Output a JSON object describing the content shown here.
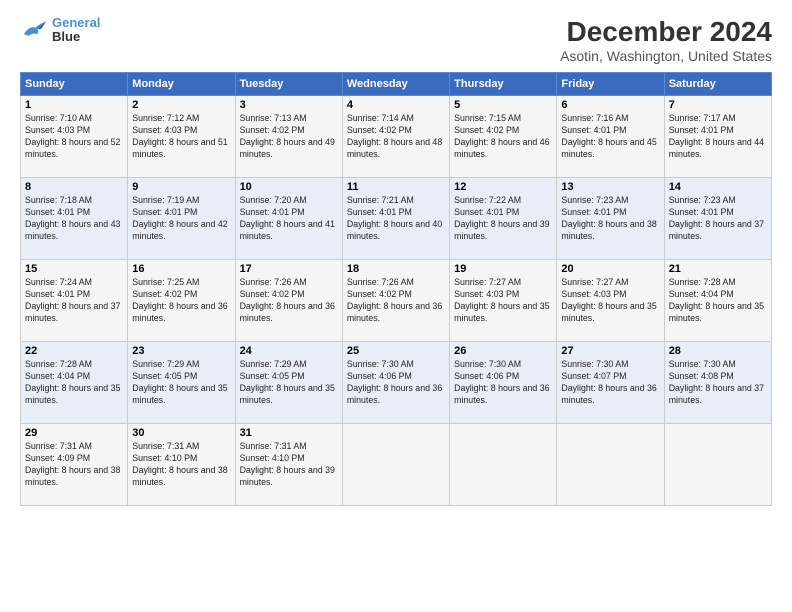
{
  "logo": {
    "line1": "General",
    "line2": "Blue"
  },
  "title": "December 2024",
  "subtitle": "Asotin, Washington, United States",
  "headers": [
    "Sunday",
    "Monday",
    "Tuesday",
    "Wednesday",
    "Thursday",
    "Friday",
    "Saturday"
  ],
  "weeks": [
    [
      {
        "day": "1",
        "sunrise": "7:10 AM",
        "sunset": "4:03 PM",
        "daylight": "8 hours and 52 minutes."
      },
      {
        "day": "2",
        "sunrise": "7:12 AM",
        "sunset": "4:03 PM",
        "daylight": "8 hours and 51 minutes."
      },
      {
        "day": "3",
        "sunrise": "7:13 AM",
        "sunset": "4:02 PM",
        "daylight": "8 hours and 49 minutes."
      },
      {
        "day": "4",
        "sunrise": "7:14 AM",
        "sunset": "4:02 PM",
        "daylight": "8 hours and 48 minutes."
      },
      {
        "day": "5",
        "sunrise": "7:15 AM",
        "sunset": "4:02 PM",
        "daylight": "8 hours and 46 minutes."
      },
      {
        "day": "6",
        "sunrise": "7:16 AM",
        "sunset": "4:01 PM",
        "daylight": "8 hours and 45 minutes."
      },
      {
        "day": "7",
        "sunrise": "7:17 AM",
        "sunset": "4:01 PM",
        "daylight": "8 hours and 44 minutes."
      }
    ],
    [
      {
        "day": "8",
        "sunrise": "7:18 AM",
        "sunset": "4:01 PM",
        "daylight": "8 hours and 43 minutes."
      },
      {
        "day": "9",
        "sunrise": "7:19 AM",
        "sunset": "4:01 PM",
        "daylight": "8 hours and 42 minutes."
      },
      {
        "day": "10",
        "sunrise": "7:20 AM",
        "sunset": "4:01 PM",
        "daylight": "8 hours and 41 minutes."
      },
      {
        "day": "11",
        "sunrise": "7:21 AM",
        "sunset": "4:01 PM",
        "daylight": "8 hours and 40 minutes."
      },
      {
        "day": "12",
        "sunrise": "7:22 AM",
        "sunset": "4:01 PM",
        "daylight": "8 hours and 39 minutes."
      },
      {
        "day": "13",
        "sunrise": "7:23 AM",
        "sunset": "4:01 PM",
        "daylight": "8 hours and 38 minutes."
      },
      {
        "day": "14",
        "sunrise": "7:23 AM",
        "sunset": "4:01 PM",
        "daylight": "8 hours and 37 minutes."
      }
    ],
    [
      {
        "day": "15",
        "sunrise": "7:24 AM",
        "sunset": "4:01 PM",
        "daylight": "8 hours and 37 minutes."
      },
      {
        "day": "16",
        "sunrise": "7:25 AM",
        "sunset": "4:02 PM",
        "daylight": "8 hours and 36 minutes."
      },
      {
        "day": "17",
        "sunrise": "7:26 AM",
        "sunset": "4:02 PM",
        "daylight": "8 hours and 36 minutes."
      },
      {
        "day": "18",
        "sunrise": "7:26 AM",
        "sunset": "4:02 PM",
        "daylight": "8 hours and 36 minutes."
      },
      {
        "day": "19",
        "sunrise": "7:27 AM",
        "sunset": "4:03 PM",
        "daylight": "8 hours and 35 minutes."
      },
      {
        "day": "20",
        "sunrise": "7:27 AM",
        "sunset": "4:03 PM",
        "daylight": "8 hours and 35 minutes."
      },
      {
        "day": "21",
        "sunrise": "7:28 AM",
        "sunset": "4:04 PM",
        "daylight": "8 hours and 35 minutes."
      }
    ],
    [
      {
        "day": "22",
        "sunrise": "7:28 AM",
        "sunset": "4:04 PM",
        "daylight": "8 hours and 35 minutes."
      },
      {
        "day": "23",
        "sunrise": "7:29 AM",
        "sunset": "4:05 PM",
        "daylight": "8 hours and 35 minutes."
      },
      {
        "day": "24",
        "sunrise": "7:29 AM",
        "sunset": "4:05 PM",
        "daylight": "8 hours and 35 minutes."
      },
      {
        "day": "25",
        "sunrise": "7:30 AM",
        "sunset": "4:06 PM",
        "daylight": "8 hours and 36 minutes."
      },
      {
        "day": "26",
        "sunrise": "7:30 AM",
        "sunset": "4:06 PM",
        "daylight": "8 hours and 36 minutes."
      },
      {
        "day": "27",
        "sunrise": "7:30 AM",
        "sunset": "4:07 PM",
        "daylight": "8 hours and 36 minutes."
      },
      {
        "day": "28",
        "sunrise": "7:30 AM",
        "sunset": "4:08 PM",
        "daylight": "8 hours and 37 minutes."
      }
    ],
    [
      {
        "day": "29",
        "sunrise": "7:31 AM",
        "sunset": "4:09 PM",
        "daylight": "8 hours and 38 minutes."
      },
      {
        "day": "30",
        "sunrise": "7:31 AM",
        "sunset": "4:10 PM",
        "daylight": "8 hours and 38 minutes."
      },
      {
        "day": "31",
        "sunrise": "7:31 AM",
        "sunset": "4:10 PM",
        "daylight": "8 hours and 39 minutes."
      },
      null,
      null,
      null,
      null
    ]
  ],
  "labels": {
    "sunrise": "Sunrise:",
    "sunset": "Sunset:",
    "daylight": "Daylight:"
  }
}
